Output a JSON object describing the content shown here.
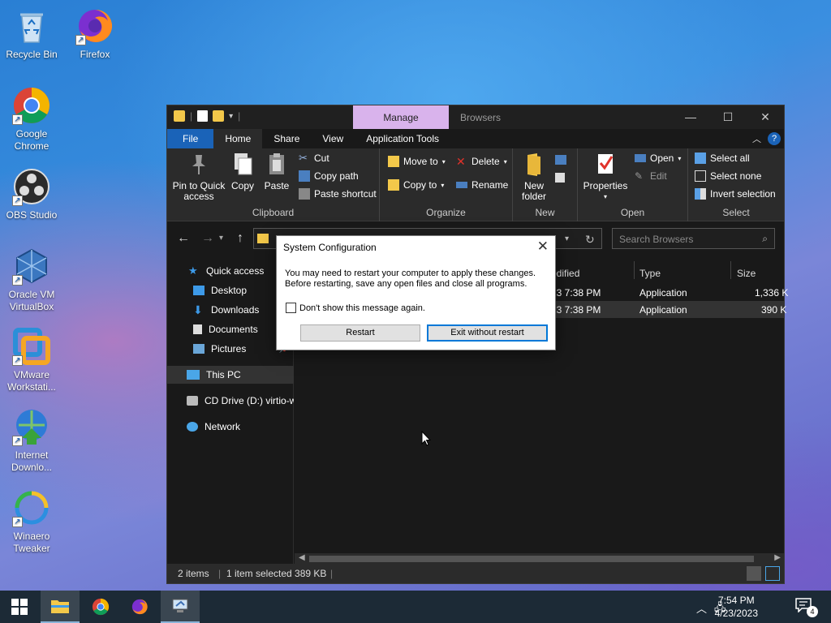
{
  "desktop": {
    "icons": [
      {
        "label": "Recycle Bin",
        "icon": "recycle-bin-icon"
      },
      {
        "label": "Firefox",
        "icon": "firefox-icon"
      },
      {
        "label": "Google Chrome",
        "icon": "chrome-icon"
      },
      {
        "label": "OBS Studio",
        "icon": "obs-icon"
      },
      {
        "label": "Oracle VM VirtualBox",
        "icon": "virtualbox-icon"
      },
      {
        "label": "VMware Workstati...",
        "icon": "vmware-icon"
      },
      {
        "label": "Internet Downlo...",
        "icon": "idm-icon"
      },
      {
        "label": "Winaero Tweaker",
        "icon": "winaero-icon"
      }
    ]
  },
  "explorer": {
    "title": "Browsers",
    "manage_tab": "Manage",
    "tabs": [
      "File",
      "Home",
      "Share",
      "View",
      "Application Tools"
    ],
    "ribbon": {
      "clipboard": {
        "label": "Clipboard",
        "pin": "Pin to Quick access",
        "copy": "Copy",
        "paste": "Paste",
        "cut": "Cut",
        "copy_path": "Copy path",
        "paste_shortcut": "Paste shortcut"
      },
      "organize": {
        "label": "Organize",
        "move_to": "Move to",
        "copy_to": "Copy to",
        "delete": "Delete",
        "rename": "Rename"
      },
      "new": {
        "label": "New",
        "new_folder": "New folder"
      },
      "open": {
        "label": "Open",
        "properties": "Properties",
        "open": "Open",
        "edit": "Edit"
      },
      "select": {
        "label": "Select",
        "select_all": "Select all",
        "select_none": "Select none",
        "invert": "Invert selection"
      }
    },
    "search_placeholder": "Search Browsers",
    "nav": {
      "quick_access": "Quick access",
      "desktop": "Desktop",
      "downloads": "Downloads",
      "documents": "Documents",
      "pictures": "Pictures",
      "this_pc": "This PC",
      "cd_drive": "CD Drive (D:) virtio-w",
      "network": "Network"
    },
    "columns": {
      "modified": "odified",
      "type": "Type",
      "size": "Size"
    },
    "rows": [
      {
        "modified": "23 7:38 PM",
        "type": "Application",
        "size": "1,336 K"
      },
      {
        "modified": "23 7:38 PM",
        "type": "Application",
        "size": "390 K"
      }
    ],
    "status": {
      "items": "2 items",
      "selected": "1 item selected  389 KB"
    }
  },
  "dialog": {
    "title": "System Configuration",
    "message_line1": "You may need to restart your computer to apply these changes.",
    "message_line2": "Before restarting, save any open files and close all programs.",
    "checkbox_label": "Don't show this message again.",
    "restart_label": "Restart",
    "exit_label": "Exit without restart"
  },
  "taskbar": {
    "time": "7:54 PM",
    "date": "4/23/2023",
    "notification_count": "4"
  }
}
